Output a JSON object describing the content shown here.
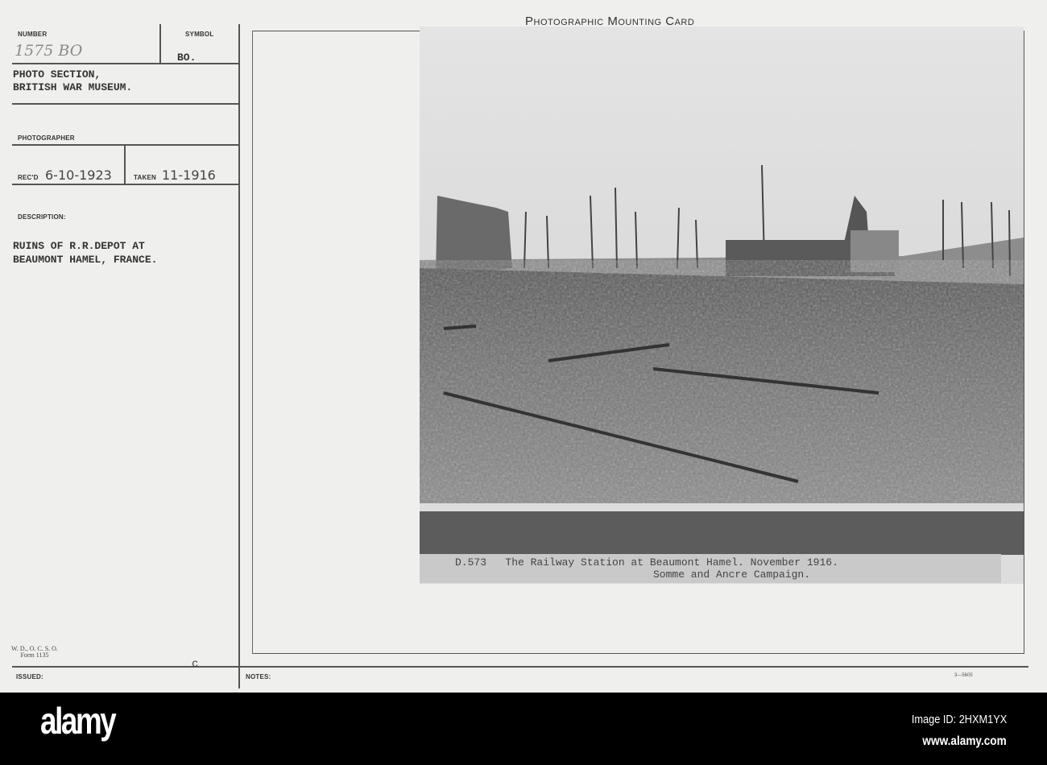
{
  "card": {
    "header_title": "Photographic Mounting Card",
    "number_label": "NUMBER",
    "number_value": "1575 BO",
    "symbol_label": "SYMBOL",
    "symbol_value": "BO.",
    "source_line1": "PHOTO SECTION,",
    "source_line2": "BRITISH WAR MUSEUM.",
    "photographer_label": "PHOTOGRAPHER",
    "recd_label": "REC'D",
    "recd_value": "6-10-1923",
    "taken_label": "TAKEN",
    "taken_value": "11-1916",
    "description_label": "DESCRIPTION:",
    "description_line1": "RUINS OF R.R.DEPOT AT",
    "description_line2": "BEAUMONT HAMEL, FRANCE.",
    "form_line1": "W. D., O. C. S. O.",
    "form_line2": "Form 1135",
    "issued_label": "ISSUED:",
    "notes_label": "NOTES:",
    "print_code": "3—5605",
    "mark_c": "c"
  },
  "photo": {
    "caption_line1": "D.573   The Railway Station at Beaumont Hamel. November 1916.",
    "caption_line2": "Somme and Ancre Campaign."
  },
  "footer": {
    "logo": "alamy",
    "image_id": "Image ID: 2HXM1YX",
    "url": "www.alamy.com"
  }
}
